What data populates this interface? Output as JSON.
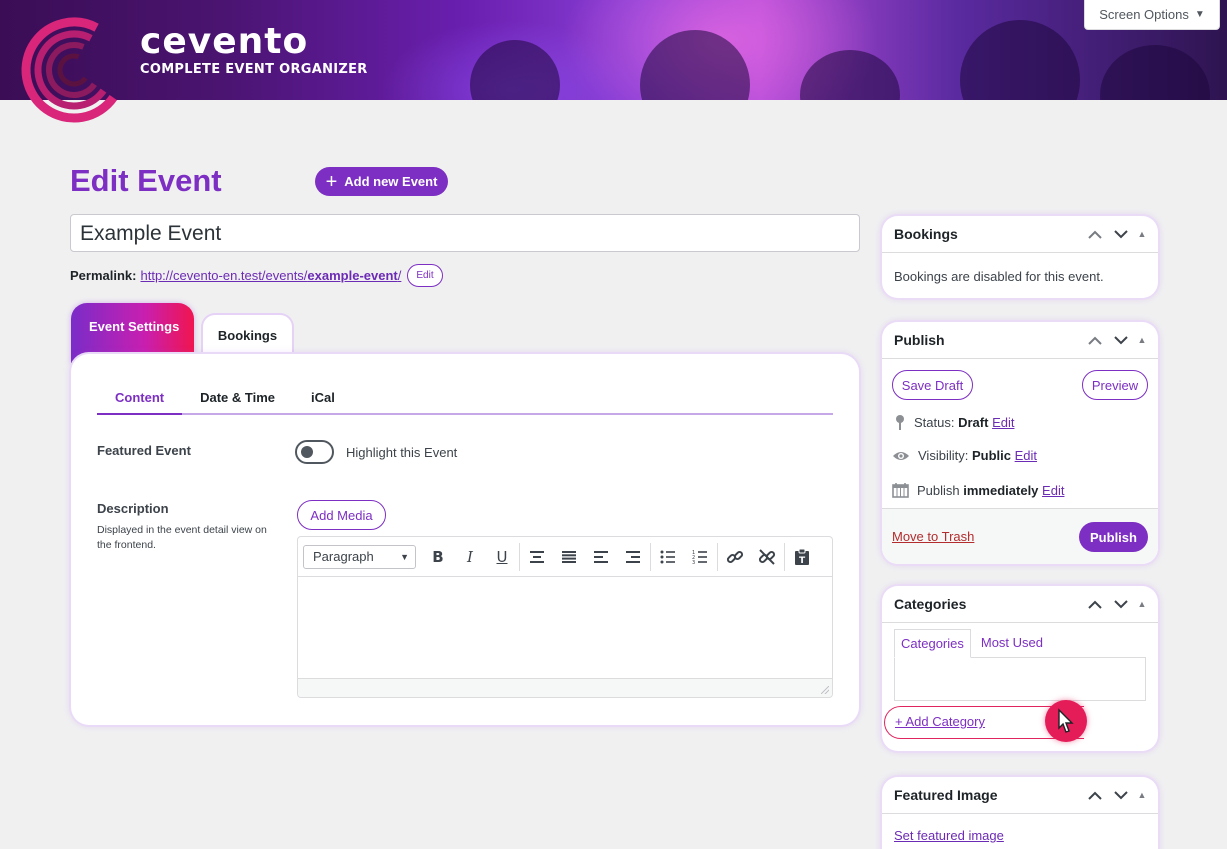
{
  "header": {
    "brand_name": "cevento",
    "brand_tagline": "COMPLETE EVENT ORGANIZER",
    "screen_options": "Screen Options"
  },
  "page": {
    "title": "Edit Event",
    "add_new_label": "Add new Event",
    "event_title_value": "Example Event",
    "permalink_label": "Permalink:",
    "permalink_base": "http://cevento-en.test/events/",
    "permalink_slug": "example-event",
    "permalink_trailing": "/",
    "permalink_edit": "Edit"
  },
  "tabs": {
    "event_settings": "Event Settings",
    "bookings": "Bookings"
  },
  "subtabs": [
    "Content",
    "Date & Time",
    "iCal"
  ],
  "content": {
    "featured_label": "Featured Event",
    "featured_toggle_label": "Highlight this Event",
    "featured_toggle_on": false,
    "description_label": "Description",
    "description_help": "Displayed in the event detail view on the frontend.",
    "add_media": "Add Media",
    "format_select_value": "Paragraph"
  },
  "sidebar": {
    "bookings": {
      "title": "Bookings",
      "text": "Bookings are disabled for this event."
    },
    "publish": {
      "title": "Publish",
      "save_draft": "Save Draft",
      "preview": "Preview",
      "status_label": "Status:",
      "status_value": "Draft",
      "visibility_label": "Visibility:",
      "visibility_value": "Public",
      "publish_label": "Publish",
      "publish_value": "immediately",
      "edit": "Edit",
      "move_to_trash": "Move to Trash",
      "publish_button": "Publish"
    },
    "categories": {
      "title": "Categories",
      "tab_all": "Categories",
      "tab_most_used": "Most Used",
      "add_category": "+ Add Category"
    },
    "featured_image": {
      "title": "Featured Image",
      "set_link": "Set featured image"
    }
  },
  "colors": {
    "accent": "#7d2fc3",
    "trash": "#b32d2e",
    "cursor": "#e41c57"
  }
}
